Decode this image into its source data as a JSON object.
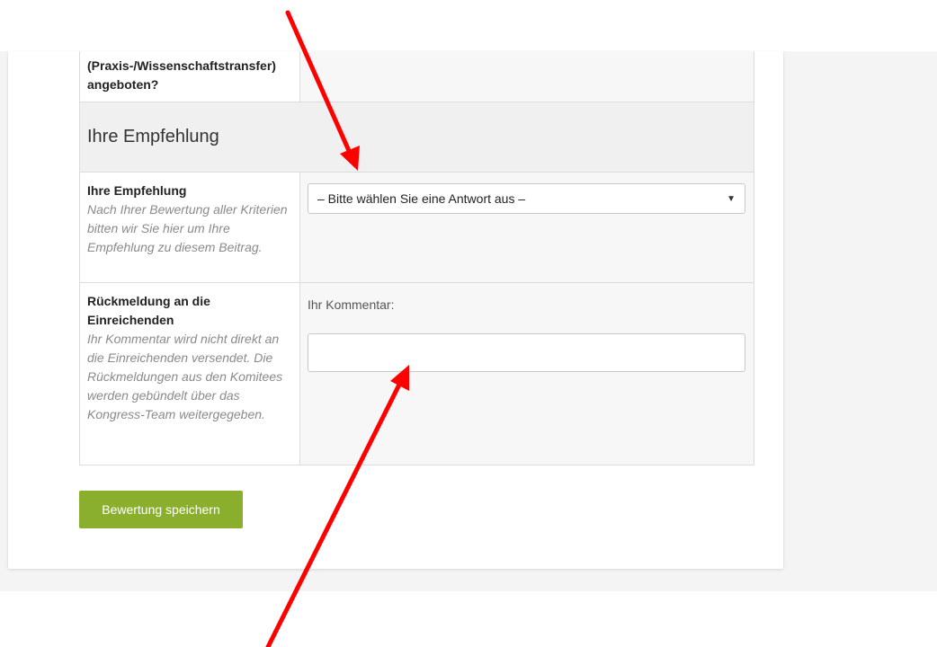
{
  "form": {
    "top_row": {
      "label": "(Praxis-/Wissenschaftstransfer) angeboten?"
    },
    "section_title": "Ihre Empfehlung",
    "recommendation": {
      "label": "Ihre Empfehlung",
      "hint": "Nach Ihrer Bewertung aller Kriterien bitten wir Sie hier um Ihre Empfehlung zu diesem Beitrag.",
      "select_value": "– Bitte wählen Sie eine Antwort aus –"
    },
    "feedback": {
      "label": "Rückmeldung an die Einreichenden",
      "hint": "Ihr Kommentar wird nicht direkt an die Einreichenden versendet. Die Rückmeldungen aus den Komitees werden gebündelt über das Kongress-Team weitergegeben.",
      "comment_label": "Ihr Kommentar:",
      "comment_value": ""
    }
  },
  "save_button_label": "Bewertung speichern",
  "colors": {
    "accent": "#8aaf2c",
    "arrow": "#ff0000"
  },
  "icons": {
    "select_arrow": "caret-down-icon"
  }
}
